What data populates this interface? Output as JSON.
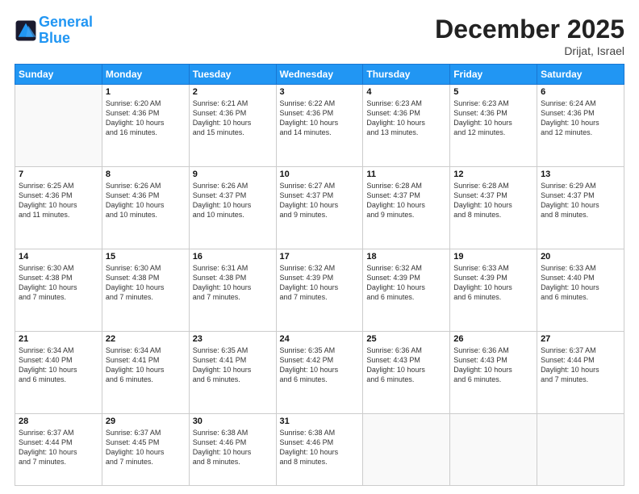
{
  "header": {
    "logo_line1": "General",
    "logo_line2": "Blue",
    "month_title": "December 2025",
    "location": "Drijat, Israel"
  },
  "weekdays": [
    "Sunday",
    "Monday",
    "Tuesday",
    "Wednesday",
    "Thursday",
    "Friday",
    "Saturday"
  ],
  "weeks": [
    [
      {
        "day": "",
        "info": ""
      },
      {
        "day": "1",
        "info": "Sunrise: 6:20 AM\nSunset: 4:36 PM\nDaylight: 10 hours\nand 16 minutes."
      },
      {
        "day": "2",
        "info": "Sunrise: 6:21 AM\nSunset: 4:36 PM\nDaylight: 10 hours\nand 15 minutes."
      },
      {
        "day": "3",
        "info": "Sunrise: 6:22 AM\nSunset: 4:36 PM\nDaylight: 10 hours\nand 14 minutes."
      },
      {
        "day": "4",
        "info": "Sunrise: 6:23 AM\nSunset: 4:36 PM\nDaylight: 10 hours\nand 13 minutes."
      },
      {
        "day": "5",
        "info": "Sunrise: 6:23 AM\nSunset: 4:36 PM\nDaylight: 10 hours\nand 12 minutes."
      },
      {
        "day": "6",
        "info": "Sunrise: 6:24 AM\nSunset: 4:36 PM\nDaylight: 10 hours\nand 12 minutes."
      }
    ],
    [
      {
        "day": "7",
        "info": "Sunrise: 6:25 AM\nSunset: 4:36 PM\nDaylight: 10 hours\nand 11 minutes."
      },
      {
        "day": "8",
        "info": "Sunrise: 6:26 AM\nSunset: 4:36 PM\nDaylight: 10 hours\nand 10 minutes."
      },
      {
        "day": "9",
        "info": "Sunrise: 6:26 AM\nSunset: 4:37 PM\nDaylight: 10 hours\nand 10 minutes."
      },
      {
        "day": "10",
        "info": "Sunrise: 6:27 AM\nSunset: 4:37 PM\nDaylight: 10 hours\nand 9 minutes."
      },
      {
        "day": "11",
        "info": "Sunrise: 6:28 AM\nSunset: 4:37 PM\nDaylight: 10 hours\nand 9 minutes."
      },
      {
        "day": "12",
        "info": "Sunrise: 6:28 AM\nSunset: 4:37 PM\nDaylight: 10 hours\nand 8 minutes."
      },
      {
        "day": "13",
        "info": "Sunrise: 6:29 AM\nSunset: 4:37 PM\nDaylight: 10 hours\nand 8 minutes."
      }
    ],
    [
      {
        "day": "14",
        "info": "Sunrise: 6:30 AM\nSunset: 4:38 PM\nDaylight: 10 hours\nand 7 minutes."
      },
      {
        "day": "15",
        "info": "Sunrise: 6:30 AM\nSunset: 4:38 PM\nDaylight: 10 hours\nand 7 minutes."
      },
      {
        "day": "16",
        "info": "Sunrise: 6:31 AM\nSunset: 4:38 PM\nDaylight: 10 hours\nand 7 minutes."
      },
      {
        "day": "17",
        "info": "Sunrise: 6:32 AM\nSunset: 4:39 PM\nDaylight: 10 hours\nand 7 minutes."
      },
      {
        "day": "18",
        "info": "Sunrise: 6:32 AM\nSunset: 4:39 PM\nDaylight: 10 hours\nand 6 minutes."
      },
      {
        "day": "19",
        "info": "Sunrise: 6:33 AM\nSunset: 4:39 PM\nDaylight: 10 hours\nand 6 minutes."
      },
      {
        "day": "20",
        "info": "Sunrise: 6:33 AM\nSunset: 4:40 PM\nDaylight: 10 hours\nand 6 minutes."
      }
    ],
    [
      {
        "day": "21",
        "info": "Sunrise: 6:34 AM\nSunset: 4:40 PM\nDaylight: 10 hours\nand 6 minutes."
      },
      {
        "day": "22",
        "info": "Sunrise: 6:34 AM\nSunset: 4:41 PM\nDaylight: 10 hours\nand 6 minutes."
      },
      {
        "day": "23",
        "info": "Sunrise: 6:35 AM\nSunset: 4:41 PM\nDaylight: 10 hours\nand 6 minutes."
      },
      {
        "day": "24",
        "info": "Sunrise: 6:35 AM\nSunset: 4:42 PM\nDaylight: 10 hours\nand 6 minutes."
      },
      {
        "day": "25",
        "info": "Sunrise: 6:36 AM\nSunset: 4:43 PM\nDaylight: 10 hours\nand 6 minutes."
      },
      {
        "day": "26",
        "info": "Sunrise: 6:36 AM\nSunset: 4:43 PM\nDaylight: 10 hours\nand 6 minutes."
      },
      {
        "day": "27",
        "info": "Sunrise: 6:37 AM\nSunset: 4:44 PM\nDaylight: 10 hours\nand 7 minutes."
      }
    ],
    [
      {
        "day": "28",
        "info": "Sunrise: 6:37 AM\nSunset: 4:44 PM\nDaylight: 10 hours\nand 7 minutes."
      },
      {
        "day": "29",
        "info": "Sunrise: 6:37 AM\nSunset: 4:45 PM\nDaylight: 10 hours\nand 7 minutes."
      },
      {
        "day": "30",
        "info": "Sunrise: 6:38 AM\nSunset: 4:46 PM\nDaylight: 10 hours\nand 8 minutes."
      },
      {
        "day": "31",
        "info": "Sunrise: 6:38 AM\nSunset: 4:46 PM\nDaylight: 10 hours\nand 8 minutes."
      },
      {
        "day": "",
        "info": ""
      },
      {
        "day": "",
        "info": ""
      },
      {
        "day": "",
        "info": ""
      }
    ]
  ]
}
